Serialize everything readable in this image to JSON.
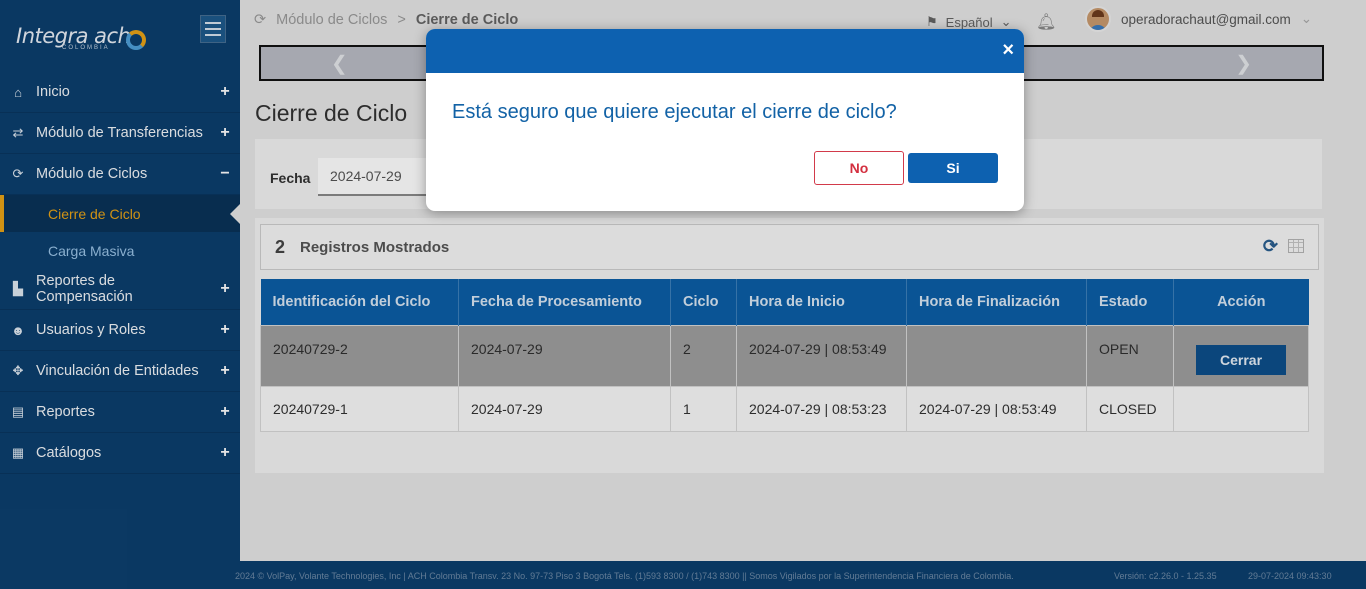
{
  "brand": {
    "name": "Integra ach",
    "sub": "COLOMBIA"
  },
  "sidebar": {
    "items": [
      {
        "label": "Inicio",
        "icon": "home-icon",
        "toggle": "+"
      },
      {
        "label": "Módulo de Transferencias",
        "icon": "transfer-icon",
        "toggle": "+"
      },
      {
        "label": "Módulo de Ciclos",
        "icon": "refresh-icon",
        "toggle": "−"
      },
      {
        "label": "Reportes de Compensación",
        "icon": "file-icon",
        "toggle": "+"
      },
      {
        "label": "Usuarios y Roles",
        "icon": "users-icon",
        "toggle": "+"
      },
      {
        "label": "Vinculación de Entidades",
        "icon": "link-icon",
        "toggle": "+"
      },
      {
        "label": "Reportes",
        "icon": "document-icon",
        "toggle": "+"
      },
      {
        "label": "Catálogos",
        "icon": "catalog-icon",
        "toggle": "+"
      }
    ],
    "subitems": [
      {
        "label": "Cierre de Ciclo",
        "active": true
      },
      {
        "label": "Carga Masiva",
        "active": false
      }
    ]
  },
  "header": {
    "breadcrumb_parent": "Módulo de Ciclos",
    "breadcrumb_separator": ">",
    "breadcrumb_current": "Cierre de Ciclo",
    "language": "Español",
    "user_email": "operadorachaut@gmail.com"
  },
  "page": {
    "title": "Cierre de Ciclo",
    "filter_label": "Fecha",
    "filter_value": "2024-07-29"
  },
  "results": {
    "count": "2",
    "count_label": "Registros Mostrados",
    "columns": [
      "Identificación del Ciclo",
      "Fecha de Procesamiento",
      "Ciclo",
      "Hora de Inicio",
      "Hora de Finalización",
      "Estado",
      "Acción"
    ],
    "rows": [
      {
        "id": "20240729-2",
        "fecha": "2024-07-29",
        "ciclo": "2",
        "inicio": "2024-07-29 | 08:53:49",
        "fin": "",
        "estado": "OPEN",
        "accion": "Cerrar"
      },
      {
        "id": "20240729-1",
        "fecha": "2024-07-29",
        "ciclo": "1",
        "inicio": "2024-07-29 | 08:53:23",
        "fin": "2024-07-29 | 08:53:49",
        "estado": "CLOSED",
        "accion": ""
      }
    ]
  },
  "footer": {
    "text": "2024 © VolPay, Volante Technologies, Inc | ACH Colombia Transv. 23 No. 97-73 Piso 3 Bogotá Tels. (1)593 8300 / (1)743 8300 || Somos Vigilados por la Superintendencia Financiera de Colombia.",
    "version": "Versión: c2.26.0 - 1.25.35",
    "datetime": "29-07-2024 09:43:30"
  },
  "modal": {
    "message": "Está seguro que quiere ejecutar el cierre de ciclo?",
    "no_label": "No",
    "si_label": "Si",
    "close_glyph": "×"
  },
  "colors": {
    "sidebar": "#0c3f6e",
    "primary": "#0d61b0",
    "accent": "#e8a317",
    "danger": "#d32f3f"
  }
}
